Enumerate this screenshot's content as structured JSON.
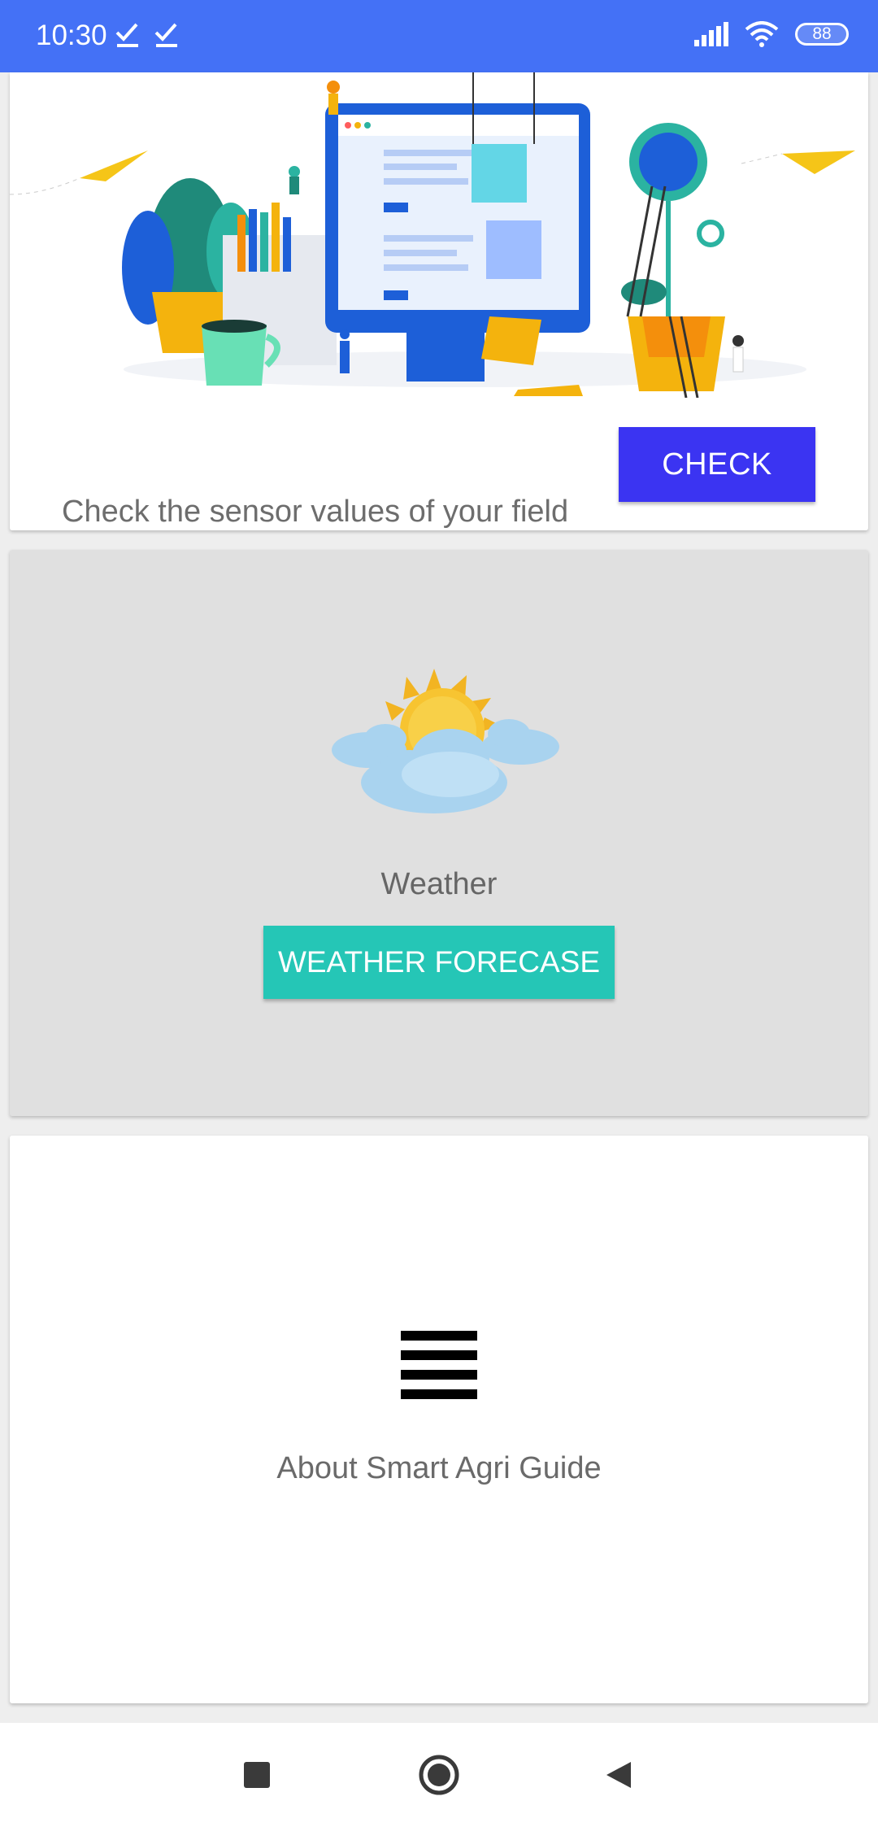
{
  "status_bar": {
    "time": "10:30",
    "battery": "88",
    "icons": [
      "check-icon",
      "check-icon",
      "signal-icon",
      "wifi-icon",
      "battery-icon"
    ]
  },
  "sensor_card": {
    "text": "Check the sensor values of your field",
    "button_label": "CHECK",
    "button_color": "#3b34f2"
  },
  "weather_card": {
    "title": "Weather",
    "button_label": "WEATHER FORECASE",
    "button_color": "#25c6b6"
  },
  "about_card": {
    "icon": "menu-icon",
    "label": "About Smart Agri Guide"
  },
  "nav_bar": {
    "icons": [
      "recents-icon",
      "home-icon",
      "back-icon"
    ]
  },
  "colors": {
    "status_bar": "#4471f6",
    "weather_card_bg": "#e0e0e0"
  }
}
